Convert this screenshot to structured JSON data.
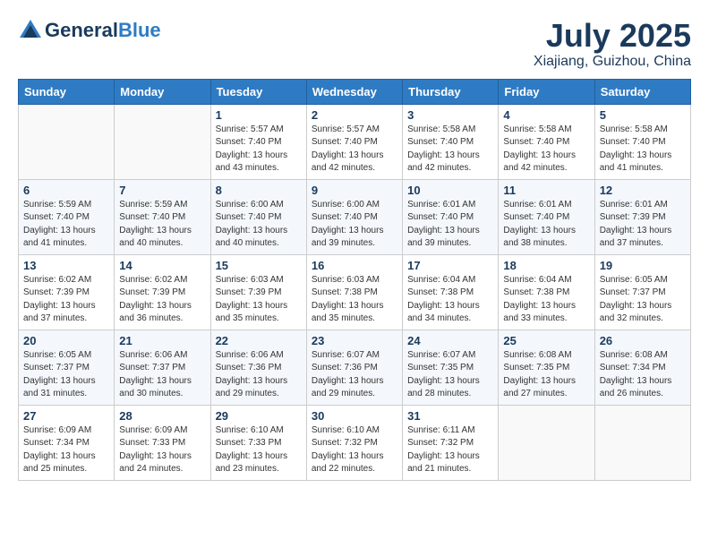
{
  "logo": {
    "general": "General",
    "blue": "Blue"
  },
  "header": {
    "month": "July 2025",
    "location": "Xiajiang, Guizhou, China"
  },
  "weekdays": [
    "Sunday",
    "Monday",
    "Tuesday",
    "Wednesday",
    "Thursday",
    "Friday",
    "Saturday"
  ],
  "weeks": [
    [
      {
        "day": "",
        "info": ""
      },
      {
        "day": "",
        "info": ""
      },
      {
        "day": "1",
        "info": "Sunrise: 5:57 AM\nSunset: 7:40 PM\nDaylight: 13 hours and 43 minutes."
      },
      {
        "day": "2",
        "info": "Sunrise: 5:57 AM\nSunset: 7:40 PM\nDaylight: 13 hours and 42 minutes."
      },
      {
        "day": "3",
        "info": "Sunrise: 5:58 AM\nSunset: 7:40 PM\nDaylight: 13 hours and 42 minutes."
      },
      {
        "day": "4",
        "info": "Sunrise: 5:58 AM\nSunset: 7:40 PM\nDaylight: 13 hours and 42 minutes."
      },
      {
        "day": "5",
        "info": "Sunrise: 5:58 AM\nSunset: 7:40 PM\nDaylight: 13 hours and 41 minutes."
      }
    ],
    [
      {
        "day": "6",
        "info": "Sunrise: 5:59 AM\nSunset: 7:40 PM\nDaylight: 13 hours and 41 minutes."
      },
      {
        "day": "7",
        "info": "Sunrise: 5:59 AM\nSunset: 7:40 PM\nDaylight: 13 hours and 40 minutes."
      },
      {
        "day": "8",
        "info": "Sunrise: 6:00 AM\nSunset: 7:40 PM\nDaylight: 13 hours and 40 minutes."
      },
      {
        "day": "9",
        "info": "Sunrise: 6:00 AM\nSunset: 7:40 PM\nDaylight: 13 hours and 39 minutes."
      },
      {
        "day": "10",
        "info": "Sunrise: 6:01 AM\nSunset: 7:40 PM\nDaylight: 13 hours and 39 minutes."
      },
      {
        "day": "11",
        "info": "Sunrise: 6:01 AM\nSunset: 7:40 PM\nDaylight: 13 hours and 38 minutes."
      },
      {
        "day": "12",
        "info": "Sunrise: 6:01 AM\nSunset: 7:39 PM\nDaylight: 13 hours and 37 minutes."
      }
    ],
    [
      {
        "day": "13",
        "info": "Sunrise: 6:02 AM\nSunset: 7:39 PM\nDaylight: 13 hours and 37 minutes."
      },
      {
        "day": "14",
        "info": "Sunrise: 6:02 AM\nSunset: 7:39 PM\nDaylight: 13 hours and 36 minutes."
      },
      {
        "day": "15",
        "info": "Sunrise: 6:03 AM\nSunset: 7:39 PM\nDaylight: 13 hours and 35 minutes."
      },
      {
        "day": "16",
        "info": "Sunrise: 6:03 AM\nSunset: 7:38 PM\nDaylight: 13 hours and 35 minutes."
      },
      {
        "day": "17",
        "info": "Sunrise: 6:04 AM\nSunset: 7:38 PM\nDaylight: 13 hours and 34 minutes."
      },
      {
        "day": "18",
        "info": "Sunrise: 6:04 AM\nSunset: 7:38 PM\nDaylight: 13 hours and 33 minutes."
      },
      {
        "day": "19",
        "info": "Sunrise: 6:05 AM\nSunset: 7:37 PM\nDaylight: 13 hours and 32 minutes."
      }
    ],
    [
      {
        "day": "20",
        "info": "Sunrise: 6:05 AM\nSunset: 7:37 PM\nDaylight: 13 hours and 31 minutes."
      },
      {
        "day": "21",
        "info": "Sunrise: 6:06 AM\nSunset: 7:37 PM\nDaylight: 13 hours and 30 minutes."
      },
      {
        "day": "22",
        "info": "Sunrise: 6:06 AM\nSunset: 7:36 PM\nDaylight: 13 hours and 29 minutes."
      },
      {
        "day": "23",
        "info": "Sunrise: 6:07 AM\nSunset: 7:36 PM\nDaylight: 13 hours and 29 minutes."
      },
      {
        "day": "24",
        "info": "Sunrise: 6:07 AM\nSunset: 7:35 PM\nDaylight: 13 hours and 28 minutes."
      },
      {
        "day": "25",
        "info": "Sunrise: 6:08 AM\nSunset: 7:35 PM\nDaylight: 13 hours and 27 minutes."
      },
      {
        "day": "26",
        "info": "Sunrise: 6:08 AM\nSunset: 7:34 PM\nDaylight: 13 hours and 26 minutes."
      }
    ],
    [
      {
        "day": "27",
        "info": "Sunrise: 6:09 AM\nSunset: 7:34 PM\nDaylight: 13 hours and 25 minutes."
      },
      {
        "day": "28",
        "info": "Sunrise: 6:09 AM\nSunset: 7:33 PM\nDaylight: 13 hours and 24 minutes."
      },
      {
        "day": "29",
        "info": "Sunrise: 6:10 AM\nSunset: 7:33 PM\nDaylight: 13 hours and 23 minutes."
      },
      {
        "day": "30",
        "info": "Sunrise: 6:10 AM\nSunset: 7:32 PM\nDaylight: 13 hours and 22 minutes."
      },
      {
        "day": "31",
        "info": "Sunrise: 6:11 AM\nSunset: 7:32 PM\nDaylight: 13 hours and 21 minutes."
      },
      {
        "day": "",
        "info": ""
      },
      {
        "day": "",
        "info": ""
      }
    ]
  ]
}
